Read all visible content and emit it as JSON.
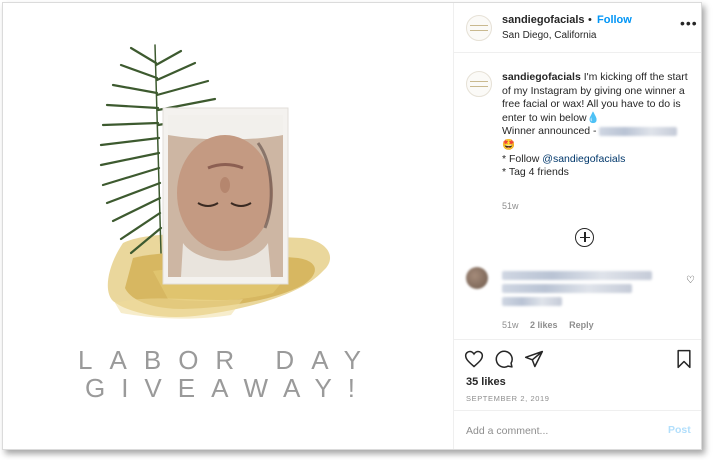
{
  "header": {
    "username": "sandiegofacials",
    "separator": "•",
    "follow_label": "Follow",
    "location": "San Diego, California",
    "more_label": "•••"
  },
  "post_image": {
    "title_line1": "LABOR DAY",
    "title_line2": "GIVEAWAY!",
    "text_color": "#9a9a9a",
    "gold_color": "#d9b64a",
    "palm_color": "#3d5a2f"
  },
  "caption": {
    "username": "sandiegofacials",
    "text_part1": "I'm kicking off the start of my Instagram by giving one winner a free facial or wax! All you have to do is enter to win below",
    "emoji_drop": "💧",
    "winner_text": "Winner announced -",
    "emoji_face": "🤩",
    "bullet1_prefix": "* Follow",
    "bullet1_mention": "@sandiegofacials",
    "bullet2": "* Tag 4 friends",
    "time": "51w"
  },
  "load_more_icon": "plus-circle-icon",
  "comment": {
    "time": "51w",
    "likes": "2 likes",
    "reply_label": "Reply"
  },
  "actions": {
    "likes": "35 likes",
    "date": "SEPTEMBER 2, 2019"
  },
  "add_comment": {
    "placeholder": "Add a comment...",
    "post_label": "Post"
  },
  "colors": {
    "link_blue": "#0095f6",
    "post_disabled": "#b2dffc",
    "muted": "#8e8e8e",
    "text": "#262626"
  }
}
